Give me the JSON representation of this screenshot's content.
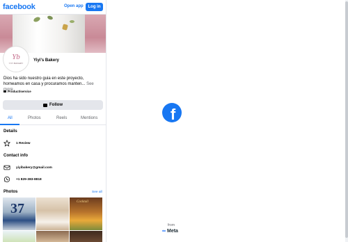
{
  "header": {
    "logo": "facebook",
    "open_app": "Open app",
    "login": "Log in"
  },
  "profile": {
    "name": "Yiyi's Bakery",
    "avatar_mark": "Yb",
    "avatar_text": "YIYI BAKERY",
    "bio": "Dios ha sido nuestro guia en este proyecto, horneamos en casa y procuramos manten...",
    "see_more": "See more",
    "category": "Product/service",
    "follow": "Follow"
  },
  "tabs": [
    {
      "label": "All",
      "active": true
    },
    {
      "label": "Photos",
      "active": false
    },
    {
      "label": "Reels",
      "active": false
    },
    {
      "label": "Mentions",
      "active": false
    }
  ],
  "details": {
    "title": "Details",
    "review": "1 Review"
  },
  "contact": {
    "title": "Contact info",
    "email": "yiyibakery@gmail.com",
    "phone": "+1 829-383-8818"
  },
  "photos": {
    "title": "Photos",
    "see_all": "See all",
    "photo1_text": "37",
    "photo3_text": "Cocktail"
  },
  "branding": {
    "from": "from",
    "meta": "Meta",
    "brand_color": "#1877f2"
  }
}
